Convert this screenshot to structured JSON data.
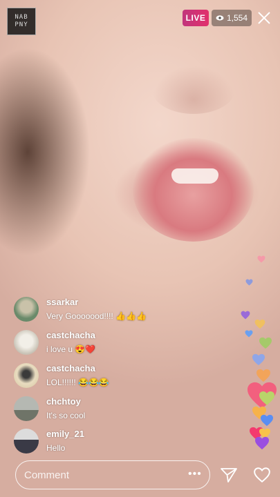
{
  "branding": {
    "logo_line1": "NAB",
    "logo_line2": "PNY"
  },
  "header": {
    "live_label": "LIVE",
    "viewer_count": "1,554"
  },
  "comments": [
    {
      "username": "ssarkar",
      "text": "Very Gooooood!!!! 👍👍👍",
      "avatar_color": "#6a8a6a"
    },
    {
      "username": "castchacha",
      "text": "i love u 😍❤️",
      "avatar_color": "#d8d2c4"
    },
    {
      "username": "castchacha",
      "text": "LOL!!!!!! 😂😂😂",
      "avatar_color": "#e4d6b4"
    },
    {
      "username": "chchtoy",
      "text": "It's so cool",
      "avatar_color": "#8a8f86"
    },
    {
      "username": "emily_21",
      "text": "Hello",
      "avatar_color": "#5a5a66"
    }
  ],
  "composer": {
    "placeholder": "Comment",
    "more_label": "•••"
  },
  "icons": {
    "close": "close-icon",
    "viewers": "eye-icon",
    "send": "send-icon",
    "like": "heart-icon"
  },
  "colors": {
    "live_badge": "#e1306c",
    "text": "#ffffff"
  }
}
